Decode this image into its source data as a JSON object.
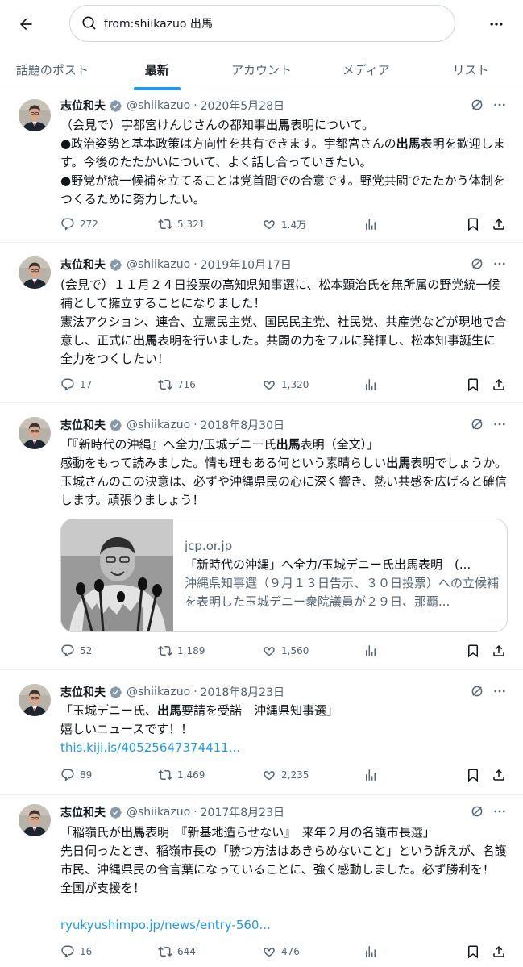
{
  "search": {
    "query": "from:shiikazuo 出馬"
  },
  "tabs": [
    "話題のポスト",
    "最新",
    "アカウント",
    "メディア",
    "リスト"
  ],
  "tweets": [
    {
      "name": "志位和夫",
      "handle": "@shiikazuo",
      "date": "2020年5月28日",
      "lines": [
        "（会見で）宇都宮けんじさんの都知事",
        "出馬",
        "表明について。",
        "●政治姿勢と基本政策は方向性を共有できます。宇都宮さんの",
        "出馬",
        "表明を歓迎します。今後のたたかいについて、よく話し合っていきたい。",
        "●野党が統一候補を立てることは党首間での合意です。野党共闘でたたかう体制をつくるために努力したい。"
      ],
      "reply": "272",
      "retweet": "5,321",
      "like": "1.4万"
    },
    {
      "name": "志位和夫",
      "handle": "@shiikazuo",
      "date": "2019年10月17日",
      "lines": [
        "(会見で）１１月２４日投票の高知県知事選に、松本顕治氏を無所属の野党統一候補として擁立することになりました！",
        "憲法アクション、連合、立憲民主党、国民民主党、社民党、共産党などが現地で合意し、正式に",
        "出馬",
        "表明を行いました。共闘の力をフルに発揮し、松本知事誕生に全力をつくしたい！"
      ],
      "reply": "17",
      "retweet": "716",
      "like": "1,320"
    },
    {
      "name": "志位和夫",
      "handle": "@shiikazuo",
      "date": "2018年8月30日",
      "lines": [
        "「『新時代の沖縄』へ全力/玉城デニー氏",
        "出馬",
        "表明（全文）」",
        "感動をもって読みました。情も理もある何という素晴らしい",
        "出馬",
        "表明でしょうか。玉城さんのこの決意は、必ずや沖縄県民の心に深く響き、熱い共感を広げると確信します。頑張りましょう！"
      ],
      "card": {
        "domain": "jcp.or.jp",
        "title": "「新時代の沖縄」へ全力/玉城デニー氏出馬表明　(...",
        "desc": "沖縄県知事選（９月１３日告示、３０日投票）への立候補を表明した玉城デニー衆院議員が２９日、那覇..."
      },
      "reply": "52",
      "retweet": "1,189",
      "like": "1,560"
    },
    {
      "name": "志位和夫",
      "handle": "@shiikazuo",
      "date": "2018年8月23日",
      "lines": [
        "「玉城デニー氏、",
        "出馬",
        "要請を受諾　沖縄県知事選」",
        "嬉しいニュースです！！"
      ],
      "link": "this.kiji.is/40525647374411...",
      "reply": "89",
      "retweet": "1,469",
      "like": "2,235"
    },
    {
      "name": "志位和夫",
      "handle": "@shiikazuo",
      "date": "2017年8月23日",
      "lines": [
        "「稲嶺氏が",
        "出馬",
        "表明　『新基地造らせない』　来年２月の名護市長選」",
        "先日伺ったとき、稲嶺市長の「勝つ方法はあきらめないこと」という訴えが、名護市民、沖縄県民の合言葉になっていることに、強く感動しました。必ず勝利を！　全国が支援を！"
      ],
      "link": "ryukyushimpo.jp/news/entry-560...",
      "reply": "16",
      "retweet": "644",
      "like": "476"
    }
  ]
}
